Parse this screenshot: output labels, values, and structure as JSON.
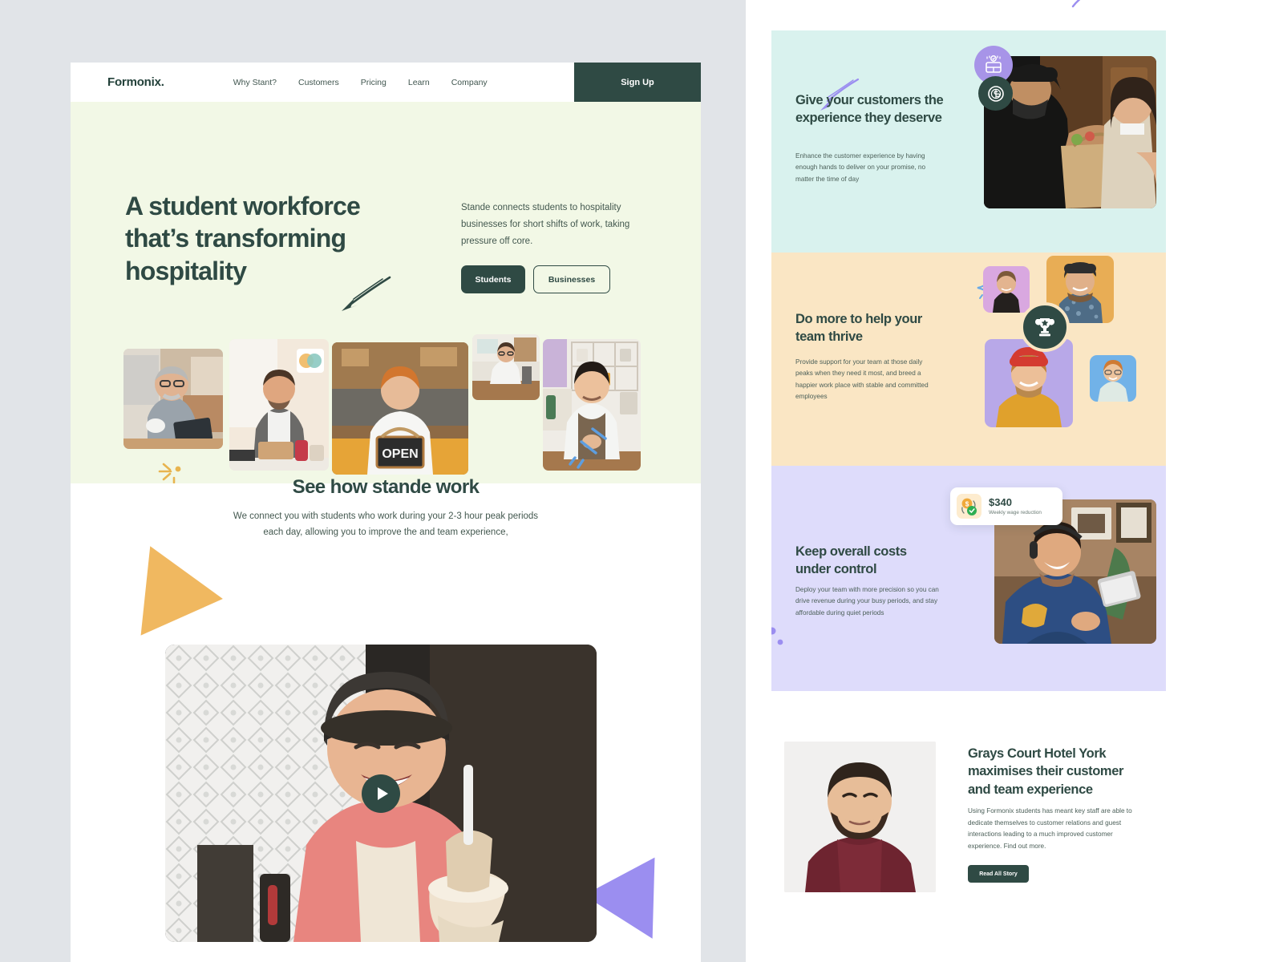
{
  "nav": {
    "logo": "Formonix.",
    "links": [
      "Why Stant?",
      "Customers",
      "Pricing",
      "Learn",
      "Company"
    ],
    "signup_label": "Sign Up"
  },
  "hero": {
    "heading": "A student workforce that’s transforming hospitality",
    "paragraph": "Stande connects students to hospitality businesses for short shifts of work, taking pressure off core.",
    "primary_button": "Students",
    "secondary_button": "Businesses",
    "photo_alt_texts": [
      "man-with-glasses-drinking-coffee-photo",
      "man-in-plaid-shirt-with-lunch-box-photo",
      "man-holding-open-sign-photo",
      "barista-writing-at-counter-photo",
      "smiling-man-in-apron-photo"
    ],
    "open_sign_text": "OPEN"
  },
  "how": {
    "heading": "See how stande work",
    "paragraph": "We connect you with students who work during your 2-3 hour peak periods each day, allowing you to improve the and team experience,",
    "video_alt": "smiling-man-holding-milkshake-video-thumbnail",
    "play_label": "Play video"
  },
  "panels": [
    {
      "id": "customers",
      "title": "Give your customers the experience they deserve",
      "body": "Enhance the customer experience by having enough hands to deliver on your promise, no matter the time of day",
      "bg": "#d9f2ee",
      "image_alt": "delivery-courier-handing-grocery-bag-to-woman-photo",
      "badges": [
        "calendar-check-icon",
        "coin-dollar-icon"
      ]
    },
    {
      "id": "team",
      "title": "Do more to help your team thrive",
      "body": "Provide support for your team at those daily peaks when they need it most, and breed a happier work place with stable and committed employees",
      "bg": "#fae6c4",
      "badge": "trophy-icon",
      "avatar_alts": [
        "smiling-man-on-pink-background-avatar",
        "man-in-cap-on-orange-background-avatar",
        "man-with-red-beanie-on-purple-background-avatar",
        "man-with-glasses-on-blue-background-avatar"
      ]
    },
    {
      "id": "costs",
      "title": "Keep overall costs under control",
      "body": "Deploy your team with more precision so you can drive revenue during your busy periods, and stay affordable during quiet periods",
      "bg": "#dedcfb",
      "image_alt": "man-with-headphones-using-tablet-photo",
      "stat": {
        "amount": "$340",
        "caption": "Weekly wage reduction",
        "icon": "money-refresh-check-icon"
      }
    }
  ],
  "story": {
    "title": "Grays Court Hotel York maximises their customer and team experience",
    "body": "Using Formonix students has meant key staff are able to dedicate themselves to customer relations and guest interactions leading to a much improved customer experience. Find out more.",
    "button_label": "Read All Story",
    "portrait_alt": "bearded-man-portrait-photo"
  },
  "colors": {
    "brand_dark": "#2f4a44",
    "hero_bg": "#f2f8e6",
    "panel_mint": "#d9f2ee",
    "panel_sand": "#fae6c4",
    "panel_lavender": "#dedcfb",
    "accent_orange": "#f0b860",
    "accent_purple": "#9b8ef0",
    "accent_blue": "#5d9ee0",
    "page_bg": "#e1e4e8"
  }
}
